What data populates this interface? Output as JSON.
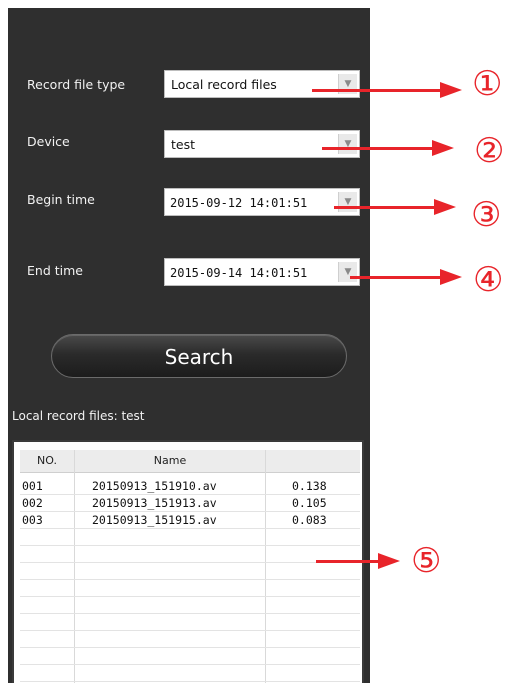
{
  "form": {
    "record_type_label": "Record file type",
    "record_type_value": "Local record files",
    "device_label": "Device",
    "device_value": "test",
    "begin_label": "Begin time",
    "begin_value": "2015-09-12 14:01:51",
    "end_label": "End time",
    "end_value": "2015-09-14 14:01:51",
    "dropdown_glyph": "▼",
    "search_label": "Search"
  },
  "results": {
    "title": "Local record files: test",
    "columns": [
      "NO.",
      "Name",
      ""
    ],
    "rows": [
      {
        "no": "001",
        "name": "20150913_151910.av",
        "size": "0.138"
      },
      {
        "no": "002",
        "name": "20150913_151913.av",
        "size": "0.105"
      },
      {
        "no": "003",
        "name": "20150913_151915.av",
        "size": "0.083"
      }
    ]
  },
  "callouts": [
    "①",
    "②",
    "③",
    "④",
    "⑤"
  ],
  "colors": {
    "annotation": "#e8242a",
    "panel": "#2f2f2f"
  }
}
